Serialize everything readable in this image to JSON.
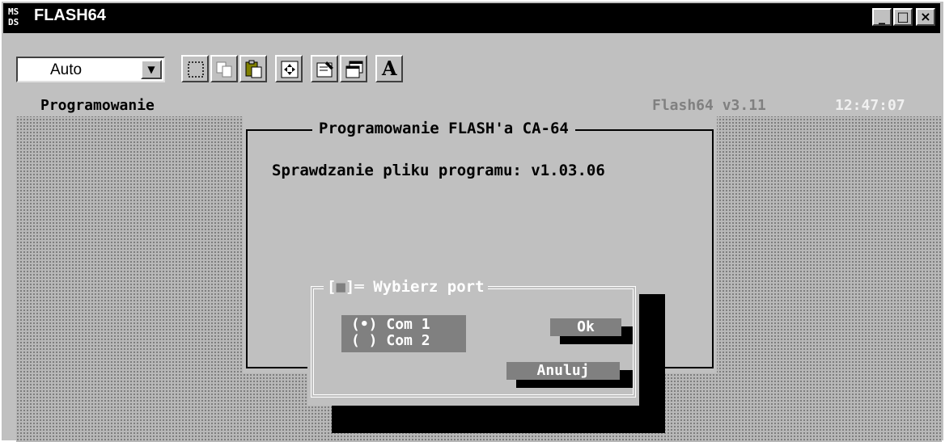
{
  "window": {
    "title": "FLASH64",
    "icon": "ms-dos-icon",
    "icon_text": "MS\nDS",
    "minimize_glyph": "_",
    "maximize_glyph": "□",
    "close_glyph": "×"
  },
  "toolbar": {
    "font_select_value": "Auto",
    "buttons": [
      "mark-icon",
      "copy-icon",
      "paste-icon",
      "fullscreen-icon",
      "properties-icon",
      "background-icon",
      "font-icon"
    ],
    "font_button_label": "A"
  },
  "console": {
    "status_left": "Programowanie",
    "status_version": "Flash64 v3.11",
    "status_time": "12:47:07",
    "panel_title": "Programowanie FLASH'a CA-64",
    "panel_message": "Sprawdzanie pliku programu: v1.03.06",
    "dialog": {
      "title": "Wybierz port",
      "close_open": "[",
      "close_mark": "■",
      "close_close": "]",
      "options": [
        {
          "marker": "(•)",
          "label": "Com 1",
          "selected": true
        },
        {
          "marker": "( )",
          "label": "Com 2",
          "selected": false
        }
      ],
      "ok_label": "Ok",
      "cancel_label": "Anuluj"
    }
  }
}
